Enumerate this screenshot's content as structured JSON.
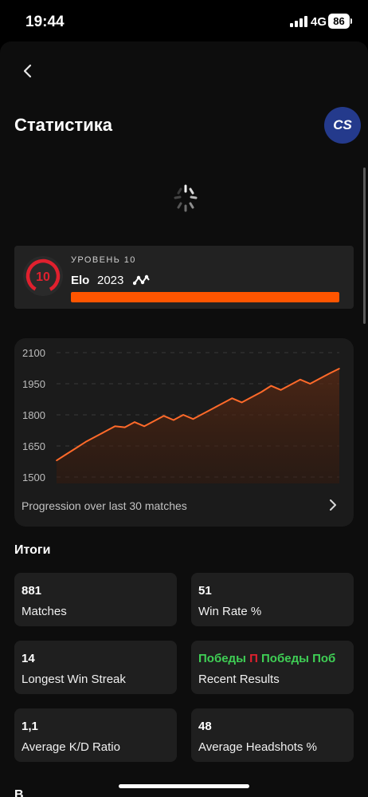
{
  "status_bar": {
    "time": "19:44",
    "network": "4G",
    "battery": "86"
  },
  "header": {
    "title": "Статистика",
    "game_logo_text": "CS",
    "icons": {
      "back": "chevron-left-icon",
      "game": "cs-logo-icon",
      "loading": "spinner-icon"
    }
  },
  "level": {
    "label": "УРОВЕНЬ 10",
    "badge": "10",
    "elo_label": "Elo",
    "elo_value": "2023",
    "progress": 1.0,
    "accent": "#ff5500",
    "badge_color": "#e0202e"
  },
  "chart": {
    "caption": "Progression over last 30 matches",
    "line_color": "#ff6a2a"
  },
  "chart_data": {
    "type": "area",
    "title": "",
    "xlabel": "",
    "ylabel": "",
    "ylim": [
      1500,
      2100
    ],
    "yticks": [
      "2100",
      "1950",
      "1800",
      "1650",
      "1500"
    ],
    "grid": true,
    "series": [
      {
        "values": [
          1580,
          1610,
          1640,
          1670,
          1695,
          1720,
          1745,
          1740,
          1765,
          1745,
          1770,
          1795,
          1775,
          1800,
          1780,
          1805,
          1830,
          1855,
          1880,
          1860,
          1885,
          1910,
          1940,
          1920,
          1945,
          1970,
          1950,
          1975,
          2000,
          2023
        ]
      }
    ]
  },
  "summary": {
    "title": "Итоги",
    "cards": [
      {
        "value": "881",
        "label": "Matches"
      },
      {
        "value": "51",
        "label": "Win Rate %"
      },
      {
        "value": "14",
        "label": "Longest Win Streak"
      },
      {
        "value": "",
        "label": "Recent Results"
      },
      {
        "value": "1,1",
        "label": "Average K/D Ratio"
      },
      {
        "value": "48",
        "label": "Average Headshots %"
      }
    ],
    "recent_results": [
      {
        "text": "Победы",
        "color": "#3fcf55"
      },
      {
        "text": "П",
        "color": "#e0202e"
      },
      {
        "text": "Победы",
        "color": "#3fcf55"
      },
      {
        "text": "Поб",
        "color": "#3fcf55"
      }
    ]
  },
  "next_section": {
    "title": "В"
  }
}
